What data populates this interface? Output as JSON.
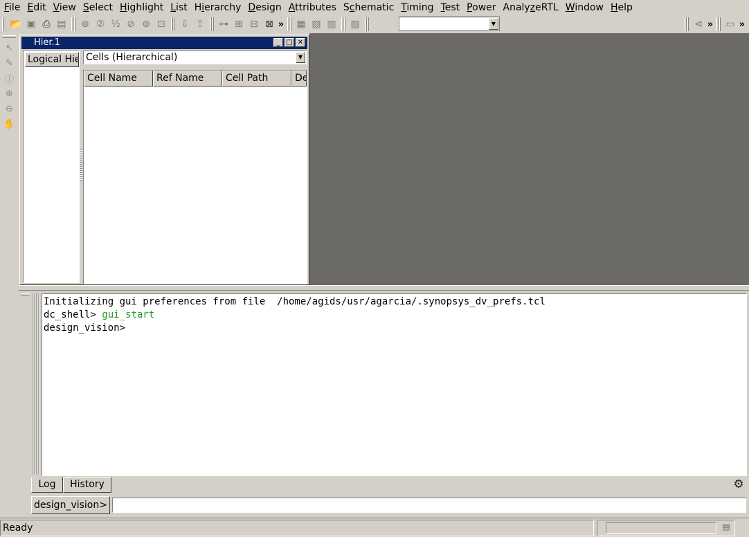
{
  "menu": [
    {
      "pre": "",
      "ul": "F",
      "post": "ile"
    },
    {
      "pre": "",
      "ul": "E",
      "post": "dit"
    },
    {
      "pre": "",
      "ul": "V",
      "post": "iew"
    },
    {
      "pre": "",
      "ul": "S",
      "post": "elect"
    },
    {
      "pre": "",
      "ul": "H",
      "post": "ighlight"
    },
    {
      "pre": "",
      "ul": "L",
      "post": "ist"
    },
    {
      "pre": "H",
      "ul": "i",
      "post": "erarchy"
    },
    {
      "pre": "",
      "ul": "D",
      "post": "esign"
    },
    {
      "pre": "",
      "ul": "A",
      "post": "ttributes"
    },
    {
      "pre": "S",
      "ul": "c",
      "post": "hematic"
    },
    {
      "pre": "",
      "ul": "T",
      "post": "iming"
    },
    {
      "pre": "",
      "ul": "T",
      "post": "est"
    },
    {
      "pre": "",
      "ul": "P",
      "post": "ower"
    },
    {
      "pre": "Analy",
      "ul": "z",
      "post": "eRTL"
    },
    {
      "pre": "",
      "ul": "W",
      "post": "indow"
    },
    {
      "pre": "",
      "ul": "H",
      "post": "elp"
    }
  ],
  "toolbar": {
    "more_symbol": "»",
    "select_value": ""
  },
  "hier_window": {
    "title": "Hier.1",
    "minimize": "_",
    "maximize": "□",
    "close": "✕",
    "left_tab": "Logical Hie",
    "view_combo": "Cells (Hierarchical)",
    "columns": [
      "Cell Name",
      "Ref Name",
      "Cell Path",
      "De"
    ]
  },
  "console": {
    "line1": "Initializing gui preferences from file  /home/agids/usr/agarcia/.synopsys_dv_prefs.tcl",
    "line2_prompt": "dc_shell> ",
    "line2_cmd": "gui_start",
    "line3": "design_vision>"
  },
  "console_tabs": {
    "log": "Log",
    "history": "History"
  },
  "prompt": {
    "label": "design_vision>",
    "input_value": ""
  },
  "status": {
    "text": "Ready"
  }
}
